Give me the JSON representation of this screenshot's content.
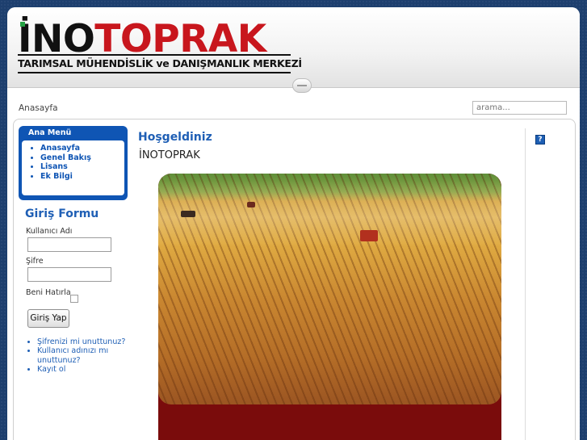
{
  "header": {
    "logo_main_dark": "İNO",
    "logo_main_red": "TOPRAK",
    "logo_subtitle": "TARIMSAL MÜHENDİSLİK ve DANIŞMANLIK MERKEZİ"
  },
  "breadcrumb": "Anasayfa",
  "search": {
    "placeholder": "arama..."
  },
  "main_menu": {
    "title": "Ana Menü",
    "items": [
      {
        "label": "Anasayfa"
      },
      {
        "label": "Genel Bakış"
      },
      {
        "label": "Lisans"
      },
      {
        "label": "Ek Bilgi"
      }
    ]
  },
  "login": {
    "title": "Giriş Formu",
    "username_label": "Kullanıcı Adı",
    "password_label": "Şifre",
    "remember_label": "Beni Hatırla",
    "submit_label": "Giriş Yap",
    "links": [
      {
        "label": "Şifrenizi mi unuttunuz?"
      },
      {
        "label": "Kullanıcı adınızı mı unuttunuz?"
      },
      {
        "label": "Kayıt ol"
      }
    ]
  },
  "article": {
    "title": "Hoşgeldiniz",
    "subtitle": "İNOTOPRAK"
  },
  "help_icon": "?",
  "colors": {
    "background": "#1d3f6e",
    "brand_red": "#c8161d",
    "menu_blue": "#0f55b4",
    "link_blue": "#1f5fb5",
    "hero_frame": "#7a0c0c"
  }
}
